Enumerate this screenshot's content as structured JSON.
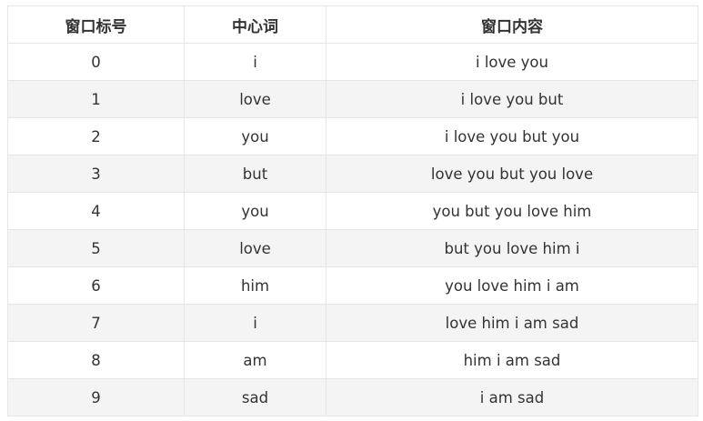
{
  "table": {
    "headers": [
      "窗口标号",
      "中心词",
      "窗口内容"
    ],
    "rows": [
      [
        "0",
        "i",
        "i love you"
      ],
      [
        "1",
        "love",
        "i love you but"
      ],
      [
        "2",
        "you",
        "i love you but you"
      ],
      [
        "3",
        "but",
        "love you but you love"
      ],
      [
        "4",
        "you",
        "you but you love him"
      ],
      [
        "5",
        "love",
        "but you love him i"
      ],
      [
        "6",
        "him",
        "you love him i am"
      ],
      [
        "7",
        "i",
        "love him i am sad"
      ],
      [
        "8",
        "am",
        "him i am sad"
      ],
      [
        "9",
        "sad",
        "i am sad"
      ]
    ]
  }
}
